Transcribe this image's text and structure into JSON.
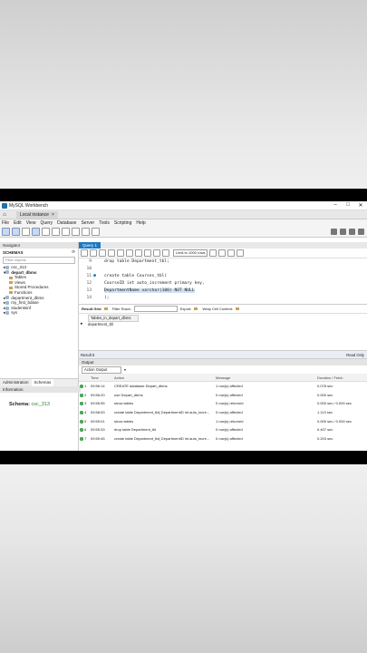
{
  "window": {
    "title": "MySQL Workbench"
  },
  "tabs": {
    "connection": "Local instance",
    "close": "×"
  },
  "menu": [
    "File",
    "Edit",
    "View",
    "Query",
    "Database",
    "Server",
    "Tools",
    "Scripting",
    "Help"
  ],
  "navigator": {
    "header": "Navigator",
    "schemas_label": "SCHEMAS",
    "filter_placeholder": "Filter objects",
    "tree": [
      "csc_313",
      "depart_dbms",
      "Tables",
      "Views",
      "Stored Procedures",
      "Functions",
      "department_dbms",
      "my_first_bdase",
      "studentsinf",
      "sys"
    ],
    "tabs": [
      "Administration",
      "Schemas"
    ],
    "info_header": "Information",
    "schema_label": "Schema:",
    "schema_value": "csc_313"
  },
  "query": {
    "tab": "Query 1",
    "limit": "Limit to 1000 rows",
    "lines": [
      {
        "n": "9",
        "code": "drop table Department_tbl;"
      },
      {
        "n": "10",
        "code": ""
      },
      {
        "n": "11",
        "code": "create table Courses_tbl("
      },
      {
        "n": "12",
        "code": "CourseID int auto_increment primary key,"
      },
      {
        "n": "13",
        "code": "DepartmentName varchar(100) NOT NULL"
      },
      {
        "n": "14",
        "code": ");"
      }
    ]
  },
  "result_grid": {
    "label": "Result Grid",
    "filter": "Filter Rows:",
    "export": "Export:",
    "wrap": "Wrap Cell Content:",
    "header": "Tables_in_depart_dbms",
    "row": "department_tbl",
    "result_tab": "Result 5",
    "read_only": "Read Only"
  },
  "output": {
    "header": "Output",
    "selector": "Action Output",
    "columns": [
      "",
      "Time",
      "Action",
      "Message",
      "Duration / Fetch"
    ],
    "rows": [
      [
        "1",
        "09:56:14",
        "CREATE database Depart_dbms",
        "1 row(s) affected",
        "0.078 sec"
      ],
      [
        "2",
        "09:56:20",
        "use Depart_dbms",
        "0 row(s) affected",
        "0.000 sec"
      ],
      [
        "3",
        "09:56:55",
        "show tables",
        "0 row(s) returned",
        "0.000 sec / 0.000 sec"
      ],
      [
        "4",
        "09:58:53",
        "create table Department_tbl( DepartmentID int auto_incre...",
        "0 row(s) affected",
        "1.113 sec"
      ],
      [
        "5",
        "09:59:01",
        "show tables",
        "1 row(s) returned",
        "0.000 sec / 0.000 sec"
      ],
      [
        "6",
        "09:59:33",
        "drop table Department_tbl",
        "0 row(s) affected",
        "0.407 sec"
      ],
      [
        "7",
        "09:59:45",
        "create table Department_tbl( DepartmentID int auto_incre...",
        "0 row(s) affected",
        "0.203 sec"
      ]
    ]
  }
}
